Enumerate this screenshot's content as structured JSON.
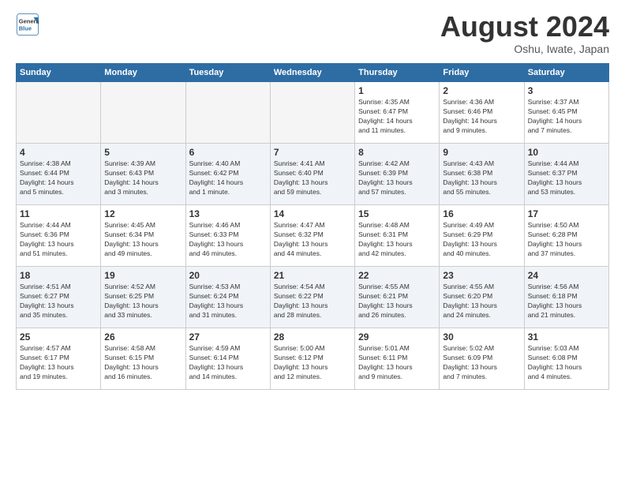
{
  "header": {
    "logo_general": "General",
    "logo_blue": "Blue",
    "month_title": "August 2024",
    "location": "Oshu, Iwate, Japan"
  },
  "weekdays": [
    "Sunday",
    "Monday",
    "Tuesday",
    "Wednesday",
    "Thursday",
    "Friday",
    "Saturday"
  ],
  "weeks": [
    [
      {
        "day": "",
        "detail": ""
      },
      {
        "day": "",
        "detail": ""
      },
      {
        "day": "",
        "detail": ""
      },
      {
        "day": "",
        "detail": ""
      },
      {
        "day": "1",
        "detail": "Sunrise: 4:35 AM\nSunset: 6:47 PM\nDaylight: 14 hours\nand 11 minutes."
      },
      {
        "day": "2",
        "detail": "Sunrise: 4:36 AM\nSunset: 6:46 PM\nDaylight: 14 hours\nand 9 minutes."
      },
      {
        "day": "3",
        "detail": "Sunrise: 4:37 AM\nSunset: 6:45 PM\nDaylight: 14 hours\nand 7 minutes."
      }
    ],
    [
      {
        "day": "4",
        "detail": "Sunrise: 4:38 AM\nSunset: 6:44 PM\nDaylight: 14 hours\nand 5 minutes."
      },
      {
        "day": "5",
        "detail": "Sunrise: 4:39 AM\nSunset: 6:43 PM\nDaylight: 14 hours\nand 3 minutes."
      },
      {
        "day": "6",
        "detail": "Sunrise: 4:40 AM\nSunset: 6:42 PM\nDaylight: 14 hours\nand 1 minute."
      },
      {
        "day": "7",
        "detail": "Sunrise: 4:41 AM\nSunset: 6:40 PM\nDaylight: 13 hours\nand 59 minutes."
      },
      {
        "day": "8",
        "detail": "Sunrise: 4:42 AM\nSunset: 6:39 PM\nDaylight: 13 hours\nand 57 minutes."
      },
      {
        "day": "9",
        "detail": "Sunrise: 4:43 AM\nSunset: 6:38 PM\nDaylight: 13 hours\nand 55 minutes."
      },
      {
        "day": "10",
        "detail": "Sunrise: 4:44 AM\nSunset: 6:37 PM\nDaylight: 13 hours\nand 53 minutes."
      }
    ],
    [
      {
        "day": "11",
        "detail": "Sunrise: 4:44 AM\nSunset: 6:36 PM\nDaylight: 13 hours\nand 51 minutes."
      },
      {
        "day": "12",
        "detail": "Sunrise: 4:45 AM\nSunset: 6:34 PM\nDaylight: 13 hours\nand 49 minutes."
      },
      {
        "day": "13",
        "detail": "Sunrise: 4:46 AM\nSunset: 6:33 PM\nDaylight: 13 hours\nand 46 minutes."
      },
      {
        "day": "14",
        "detail": "Sunrise: 4:47 AM\nSunset: 6:32 PM\nDaylight: 13 hours\nand 44 minutes."
      },
      {
        "day": "15",
        "detail": "Sunrise: 4:48 AM\nSunset: 6:31 PM\nDaylight: 13 hours\nand 42 minutes."
      },
      {
        "day": "16",
        "detail": "Sunrise: 4:49 AM\nSunset: 6:29 PM\nDaylight: 13 hours\nand 40 minutes."
      },
      {
        "day": "17",
        "detail": "Sunrise: 4:50 AM\nSunset: 6:28 PM\nDaylight: 13 hours\nand 37 minutes."
      }
    ],
    [
      {
        "day": "18",
        "detail": "Sunrise: 4:51 AM\nSunset: 6:27 PM\nDaylight: 13 hours\nand 35 minutes."
      },
      {
        "day": "19",
        "detail": "Sunrise: 4:52 AM\nSunset: 6:25 PM\nDaylight: 13 hours\nand 33 minutes."
      },
      {
        "day": "20",
        "detail": "Sunrise: 4:53 AM\nSunset: 6:24 PM\nDaylight: 13 hours\nand 31 minutes."
      },
      {
        "day": "21",
        "detail": "Sunrise: 4:54 AM\nSunset: 6:22 PM\nDaylight: 13 hours\nand 28 minutes."
      },
      {
        "day": "22",
        "detail": "Sunrise: 4:55 AM\nSunset: 6:21 PM\nDaylight: 13 hours\nand 26 minutes."
      },
      {
        "day": "23",
        "detail": "Sunrise: 4:55 AM\nSunset: 6:20 PM\nDaylight: 13 hours\nand 24 minutes."
      },
      {
        "day": "24",
        "detail": "Sunrise: 4:56 AM\nSunset: 6:18 PM\nDaylight: 13 hours\nand 21 minutes."
      }
    ],
    [
      {
        "day": "25",
        "detail": "Sunrise: 4:57 AM\nSunset: 6:17 PM\nDaylight: 13 hours\nand 19 minutes."
      },
      {
        "day": "26",
        "detail": "Sunrise: 4:58 AM\nSunset: 6:15 PM\nDaylight: 13 hours\nand 16 minutes."
      },
      {
        "day": "27",
        "detail": "Sunrise: 4:59 AM\nSunset: 6:14 PM\nDaylight: 13 hours\nand 14 minutes."
      },
      {
        "day": "28",
        "detail": "Sunrise: 5:00 AM\nSunset: 6:12 PM\nDaylight: 13 hours\nand 12 minutes."
      },
      {
        "day": "29",
        "detail": "Sunrise: 5:01 AM\nSunset: 6:11 PM\nDaylight: 13 hours\nand 9 minutes."
      },
      {
        "day": "30",
        "detail": "Sunrise: 5:02 AM\nSunset: 6:09 PM\nDaylight: 13 hours\nand 7 minutes."
      },
      {
        "day": "31",
        "detail": "Sunrise: 5:03 AM\nSunset: 6:08 PM\nDaylight: 13 hours\nand 4 minutes."
      }
    ]
  ]
}
